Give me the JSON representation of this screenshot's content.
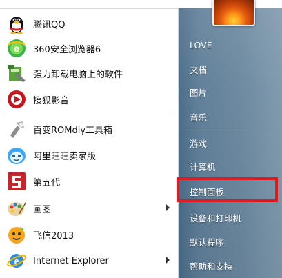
{
  "start_menu": {
    "programs": [
      {
        "label": "腾讯QQ",
        "icon": "qq-penguin-icon"
      },
      {
        "label": "360安全浏览器6",
        "icon": "360-browser-icon"
      },
      {
        "label": "强力卸载电脑上的软件",
        "icon": "uninstaller-icon"
      },
      {
        "label": "搜狐影音",
        "icon": "sohu-video-icon"
      },
      {
        "label": "百变ROMdiy工具箱",
        "icon": "romdiy-toolbox-icon"
      },
      {
        "label": "阿里旺旺卖家版",
        "icon": "aliwangwang-icon"
      },
      {
        "label": "第五代",
        "icon": "fifth-gen-icon"
      },
      {
        "label": "画图",
        "icon": "paint-icon",
        "submenu": true
      },
      {
        "label": "飞信2013",
        "icon": "fetion-icon"
      },
      {
        "label": "Internet Explorer",
        "icon": "internet-explorer-icon",
        "submenu": true
      }
    ],
    "right_links": [
      "LOVE",
      "文档",
      "图片",
      "音乐",
      "游戏",
      "计算机",
      "控制面板",
      "设备和打印机",
      "默认程序",
      "帮助和支持"
    ],
    "highlighted_link": "控制面板",
    "colors": {
      "highlight_border": "#e01b1b",
      "right_panel": "#5f7e98"
    }
  }
}
